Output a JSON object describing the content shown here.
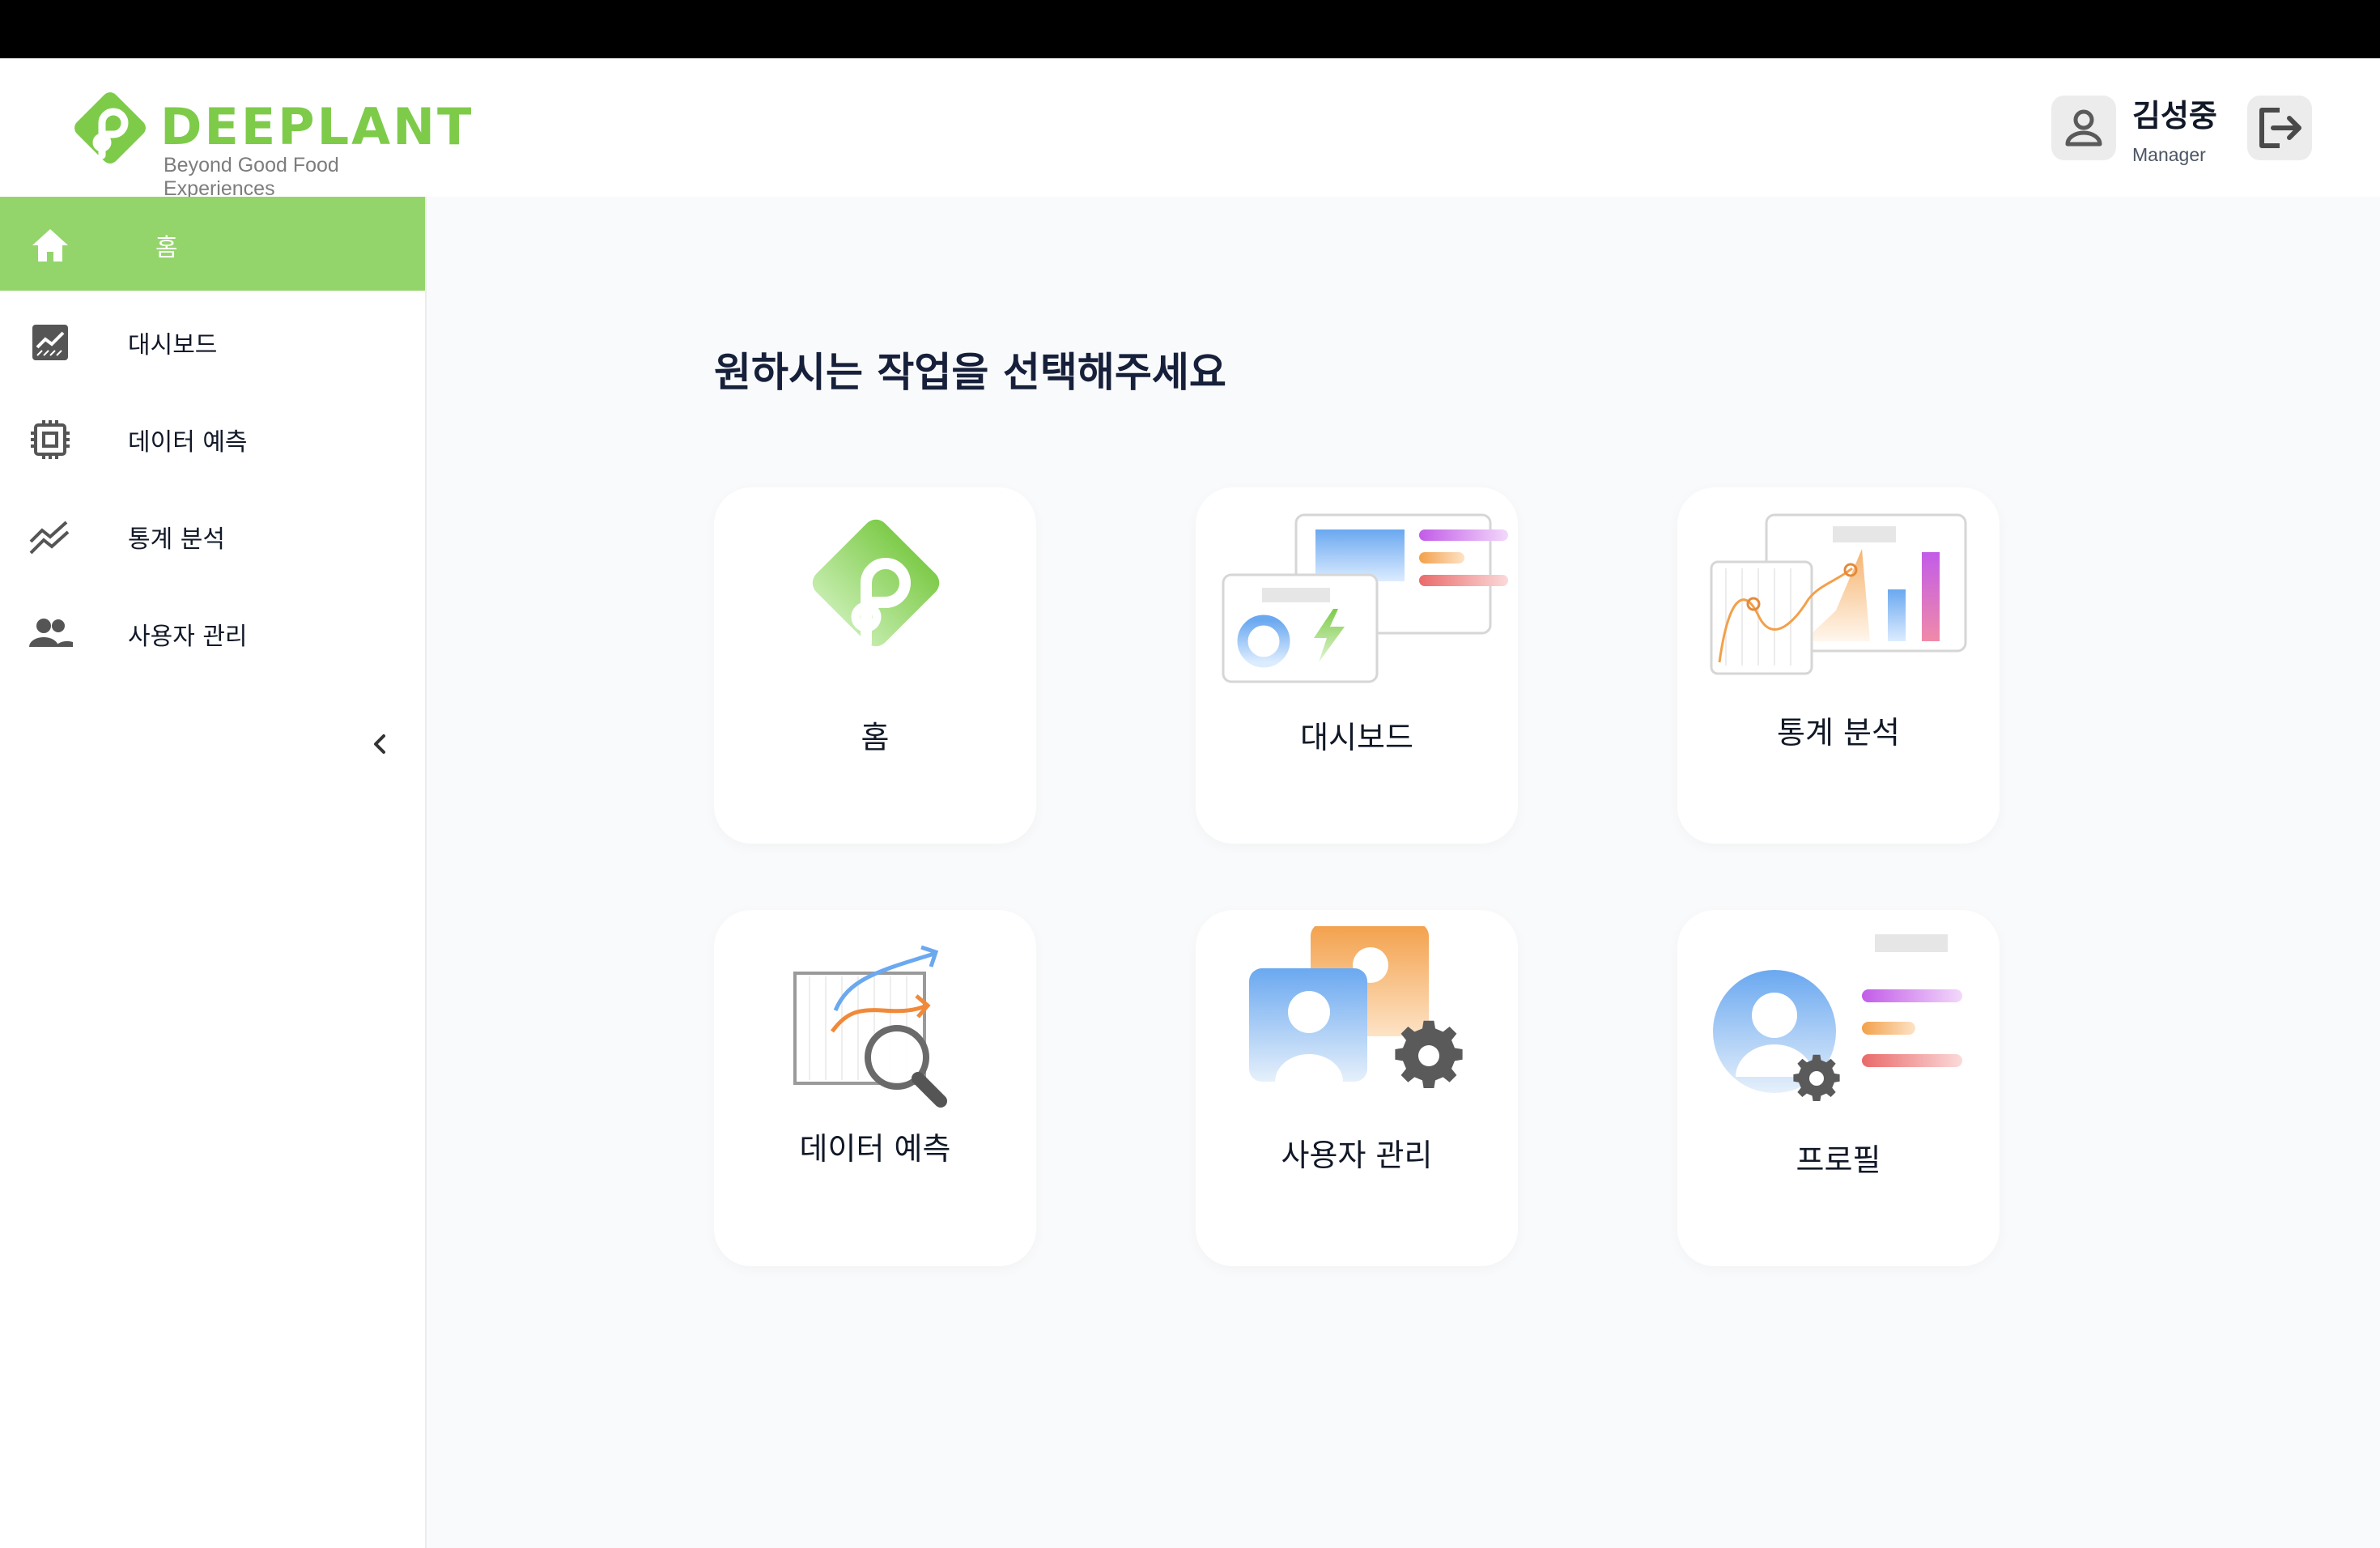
{
  "logo": {
    "word": "DEEPLANT",
    "tagline": "Beyond Good Food Experiences"
  },
  "user": {
    "name": "김성중",
    "role": "Manager"
  },
  "sidebar": {
    "items": [
      {
        "label": "홈",
        "icon": "home-icon",
        "active": true
      },
      {
        "label": "대시보드",
        "icon": "dashboard-chart-icon",
        "active": false
      },
      {
        "label": "데이터 예측",
        "icon": "chip-icon",
        "active": false
      },
      {
        "label": "통계 분석",
        "icon": "trend-lines-icon",
        "active": false
      },
      {
        "label": "사용자 관리",
        "icon": "people-icon",
        "active": false
      }
    ]
  },
  "main": {
    "title": "원하시는 작업을 선택해주세요",
    "cards": [
      {
        "label": "홈",
        "icon": "deeplant-logo-icon"
      },
      {
        "label": "대시보드",
        "icon": "dashboard-illustration-icon"
      },
      {
        "label": "통계 분석",
        "icon": "statistics-illustration-icon"
      },
      {
        "label": "데이터 예측",
        "icon": "prediction-magnifier-icon"
      },
      {
        "label": "사용자 관리",
        "icon": "users-gear-icon"
      },
      {
        "label": "프로필",
        "icon": "profile-gear-icon"
      }
    ]
  },
  "colors": {
    "accent": "#93d56b",
    "logo_green": "#7ecb4a",
    "title": "#17203a",
    "background": "#f9fafb"
  }
}
